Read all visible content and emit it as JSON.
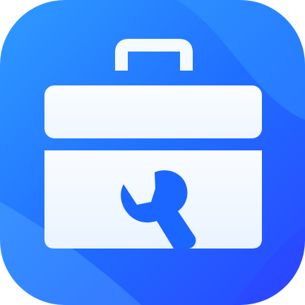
{
  "app_icon": {
    "name": "toolbox-icon",
    "tile_color_light": "#2f9bff",
    "tile_color_mid": "#1f6bff",
    "tile_color_dark": "#2b46ff",
    "box_color_light": "#f7fbff",
    "box_color_shade": "#e4f0ff",
    "wrench_color": "#1a66ff"
  }
}
